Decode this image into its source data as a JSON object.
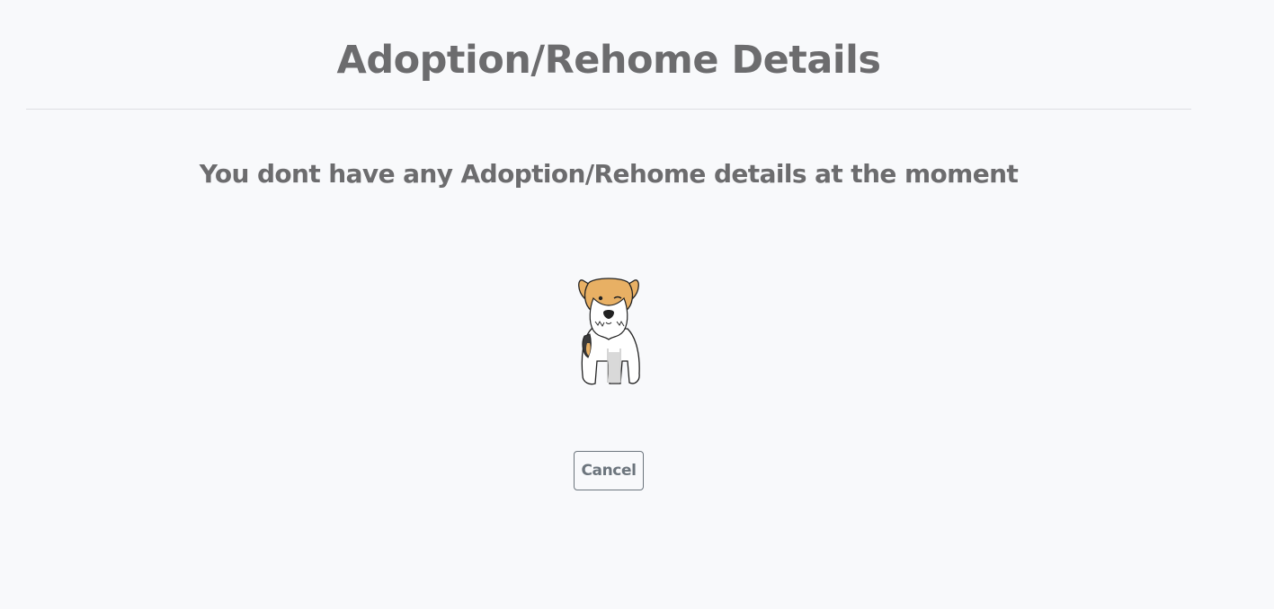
{
  "header": {
    "title": "Adoption/Rehome Details"
  },
  "main": {
    "empty_message": "You dont have any Adoption/Rehome details at the moment",
    "illustration_icon": "dog-icon",
    "cancel_label": "Cancel"
  },
  "colors": {
    "background": "#f8f9fb",
    "text": "#6c6c6e",
    "divider": "#dedfe2",
    "button_border": "#6c757d",
    "dog_tan": "#e8b064"
  }
}
